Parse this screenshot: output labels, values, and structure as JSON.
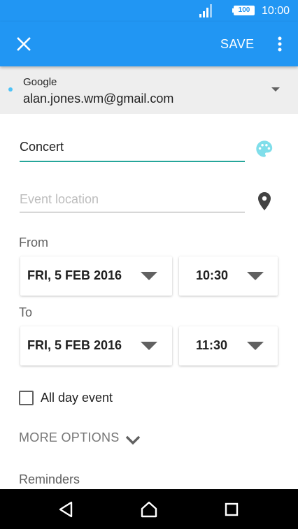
{
  "status_bar": {
    "battery_level": "100",
    "time": "10:00",
    "icons": [
      "signal-icon",
      "battery-icon"
    ]
  },
  "app_bar": {
    "close_icon": "close-icon",
    "save_label": "SAVE",
    "overflow_icon": "more-vert-icon"
  },
  "account": {
    "provider": "Google",
    "email": "alan.jones.wm@gmail.com",
    "dropdown_icon": "arrow-drop-down-icon"
  },
  "event": {
    "title": "Concert",
    "location_placeholder": "Event location",
    "location_value": "",
    "palette_icon": "palette-icon",
    "location_icon": "location-pin-icon"
  },
  "from": {
    "label": "From",
    "date": "FRI, 5 FEB 2016",
    "time": "10:30"
  },
  "to": {
    "label": "To",
    "date": "FRI, 5 FEB 2016",
    "time": "11:30"
  },
  "all_day": {
    "label": "All day event",
    "checked": false
  },
  "more_options": {
    "label": "MORE OPTIONS",
    "icon": "chevron-down-icon"
  },
  "reminders": {
    "label": "Reminders"
  },
  "nav_bar": {
    "icons": [
      "back-icon",
      "home-icon",
      "recents-icon"
    ]
  },
  "colors": {
    "primary": "#2196f3",
    "accent": "#26a69a",
    "palette": "#80deea",
    "account_band": "#eeeeee"
  }
}
